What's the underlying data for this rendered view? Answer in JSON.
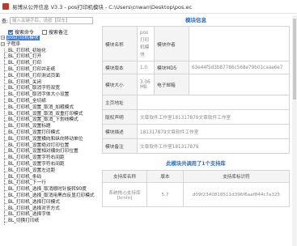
{
  "window": {
    "title": "易博从公开信息 V3.3 - pos打印机模块 - C:\\Users\\cnwan\\Desktop\\pos.ec"
  },
  "search": {
    "label": "查:",
    "placeholder": "输入关键字后，请按【回车】"
  },
  "options": [
    {
      "label": "搜索命令",
      "checked": true
    },
    {
      "label": "搜索备注",
      "checked": false
    }
  ],
  "tree": {
    "root_items": [
      {
        "label": "pos打印机模块",
        "toggle": "−",
        "selected": true
      },
      {
        "label": "子程序",
        "toggle": "−",
        "selected": false
      }
    ],
    "children": [
      "BL_打印机_初始化",
      "BL_打印机_打开",
      "BL_打印机_打印",
      "BL_打印机_打印并走纸",
      "BL_打印机_打印测试页面",
      "BL_打印机_关闭",
      "BL_打印机_取消字符双宽",
      "BL_打印机_取消字体大小设置",
      "BL_打印机_全切纸",
      "BL_打印机_设置_取消_加粗模式",
      "BL_打印机_设置_取消_双重打印模式",
      "BL_打印机_设置_取消_下划线模式",
      "BL_打印机_设置标题",
      "BL_打印机_设置打印模式",
      "BL_打印机_设置横向和纵向移动单位",
      "BL_打印机_设置绝对打印位置",
      "BL_打印机_设置相对横向打印位置",
      "BL_打印机_设置字符右间距",
      "BL_打印机_设置字符右间距",
      "BL_打印机_设置左边距",
      "BL_打印机_条码",
      "BL_打印机_下一行",
      "BL_打印机_选择_取消顺时针旋转90度",
      "BL_打印机_选择_取消用黑白反显打印模式",
      "BL_打印机_选择打印模式",
      "BL_打印机_选择对齐方式",
      "BL_打印机_选择字体",
      "BL_切换打印纸"
    ]
  },
  "module_info": {
    "heading": "模块信息",
    "name_label": "模块名称",
    "name_value": "pos打印机模块",
    "author_label": "模块作者",
    "author_value": "",
    "version_label": "模块版本",
    "version_value": "1.0",
    "md5_label": "模块MD5",
    "md5_value": "63e44f5d3b87786c568e79b01caaa6e7",
    "size_label": "模块大小",
    "size_value": "3.06 MB",
    "email_label": "电子邮箱",
    "email_value": "",
    "homepage_label": "主页地址",
    "homepage_value": "",
    "copyright_label": "版权声明",
    "copyright_value": "文章软件工作室18131787​9文章软件工作室",
    "desc_label": "模块描述",
    "desc_value": "181317879文章软件工作室",
    "note_label": "模块备注",
    "note_value": "文章软件工作室181317879"
  },
  "plugins": {
    "heading": "此模块共调用了1个支持库",
    "columns": [
      "支持库名称",
      "版本",
      "支持库标识符"
    ],
    "rows": [
      {
        "name": "系统核心支持库[krnln]",
        "version": "5.7",
        "id": "d09f2340818511d396f6aaf844c7a325"
      }
    ]
  }
}
